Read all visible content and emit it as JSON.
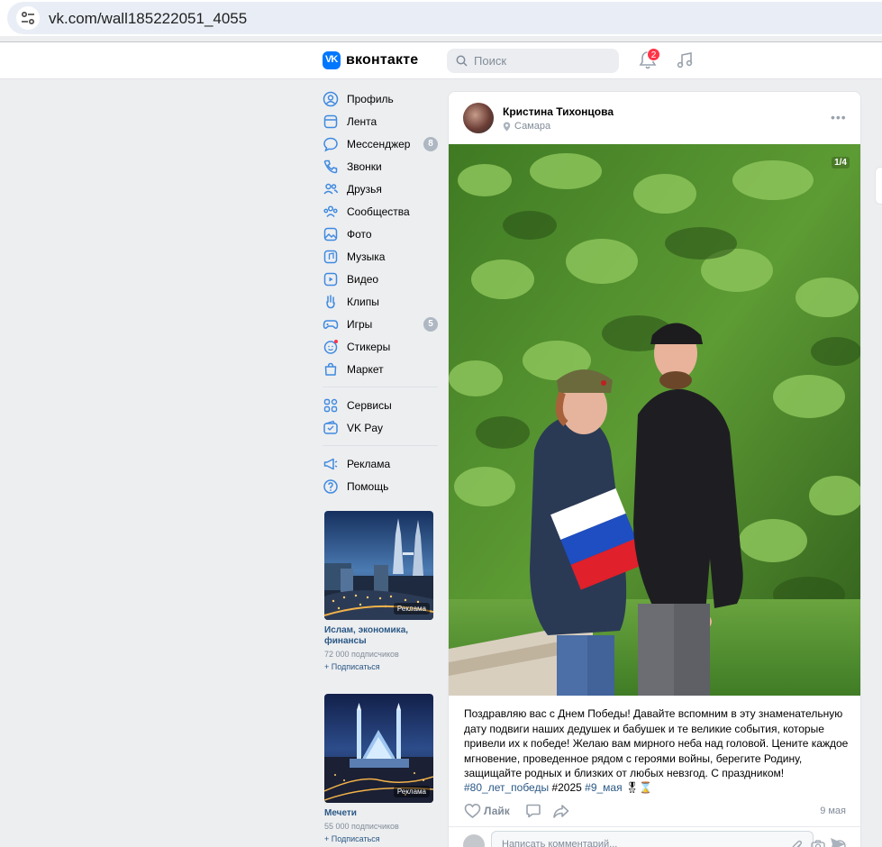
{
  "browser": {
    "url": "vk.com/wall185222051_4055",
    "tune_icon": "tune-icon"
  },
  "header": {
    "logo_text": "VK",
    "brand": "вконтакте",
    "search_placeholder": "Поиск",
    "notifications_count": "2",
    "accent_color": "#0077ff"
  },
  "nav": {
    "items": [
      {
        "label": "Профиль",
        "icon": "profile-icon"
      },
      {
        "label": "Лента",
        "icon": "feed-icon"
      },
      {
        "label": "Мессенджер",
        "icon": "messenger-icon",
        "count": "8"
      },
      {
        "label": "Звонки",
        "icon": "phone-icon"
      },
      {
        "label": "Друзья",
        "icon": "friends-icon"
      },
      {
        "label": "Сообщества",
        "icon": "communities-icon"
      },
      {
        "label": "Фото",
        "icon": "photo-icon"
      },
      {
        "label": "Музыка",
        "icon": "music-icon"
      },
      {
        "label": "Видео",
        "icon": "video-icon"
      },
      {
        "label": "Клипы",
        "icon": "clips-icon"
      },
      {
        "label": "Игры",
        "icon": "games-icon",
        "count": "5"
      },
      {
        "label": "Стикеры",
        "icon": "stickers-icon"
      },
      {
        "label": "Маркет",
        "icon": "market-icon"
      }
    ],
    "items2": [
      {
        "label": "Сервисы",
        "icon": "services-icon"
      },
      {
        "label": "VK Pay",
        "icon": "vkpay-icon"
      }
    ],
    "items3": [
      {
        "label": "Реклама",
        "icon": "ads-icon"
      },
      {
        "label": "Помощь",
        "icon": "help-icon"
      }
    ]
  },
  "ads": [
    {
      "tag": "Реклама",
      "title": "Ислам, экономика, финансы",
      "subscribers": "72 000 подписчиков",
      "subscribe": "+ Подписаться"
    },
    {
      "tag": "Реклама",
      "title": "Мечети",
      "subscribers": "55 000 подписчиков",
      "subscribe": "+ Подписаться"
    }
  ],
  "post": {
    "author": "Кристина Тихонцова",
    "location": "Самара",
    "photo_counter": "1/4",
    "text": "Поздравляю вас с Днем Победы! Давайте вспомним в эту знаменательную дату подвиги наших дедушек и бабушек и те великие события, которые привели их к победе! Желаю вам мирного неба над головой. Цените каждое мгновение, проведенное рядом с героями войны, берегите Родину, защищайте родных и близких от любых невзгод. С праздником!",
    "tag1": "#80_лет_победы",
    "tag2": "#2025",
    "tag3": "#9_мая",
    "emoji": "🎖⌛",
    "like_label": "Лайк",
    "date": "9 мая"
  },
  "comment": {
    "placeholder": "Написать комментарий..."
  }
}
